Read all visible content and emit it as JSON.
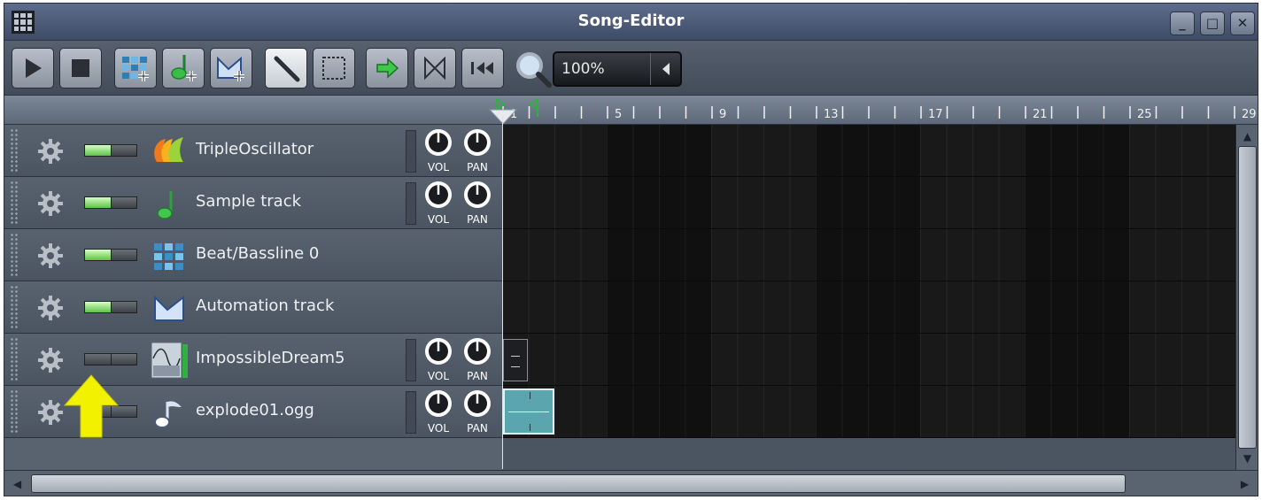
{
  "window": {
    "title": "Song-Editor",
    "buttons": {
      "minimize": "_",
      "maximize": "□",
      "close": "✕"
    }
  },
  "toolbar": {
    "zoom_value": "100%",
    "tools": [
      "play-icon",
      "stop-icon",
      "add-beat-bassline-icon",
      "add-sample-track-icon",
      "add-automation-track-icon",
      "draw-mode-icon",
      "edit-mode-icon",
      "auto-scroll-icon",
      "loop-points-icon",
      "stop-return-icon",
      "zoom-icon"
    ],
    "active_tool": "draw-mode-icon"
  },
  "timeline": {
    "bar_labels": [
      "1",
      "5",
      "9",
      "13",
      "17",
      "21",
      "25",
      "29"
    ]
  },
  "tracks": [
    {
      "name": "TripleOscillator",
      "type": "instrument",
      "muted": false,
      "has_knobs": true,
      "icon": "triple-oscillator-icon"
    },
    {
      "name": "Sample track",
      "type": "sample",
      "muted": false,
      "has_knobs": true,
      "icon": "sample-note-icon"
    },
    {
      "name": "Beat/Bassline 0",
      "type": "beat-bassline",
      "muted": false,
      "has_knobs": false,
      "icon": "beat-bassline-icon"
    },
    {
      "name": "Automation track",
      "type": "automation",
      "muted": false,
      "has_knobs": false,
      "icon": "automation-icon"
    },
    {
      "name": "ImpossibleDream5",
      "type": "instrument",
      "muted": true,
      "has_knobs": true,
      "icon": "plugin-waveform-icon"
    },
    {
      "name": "explode01.ogg",
      "type": "sample",
      "muted": true,
      "has_knobs": true,
      "icon": "audio-file-icon"
    }
  ],
  "knob_labels": {
    "vol": "VOL",
    "pan": "PAN"
  },
  "colors": {
    "led_on": "#5ec148",
    "sample_clip": "#5aa5ae",
    "annotation_arrow": "#f2f200"
  }
}
